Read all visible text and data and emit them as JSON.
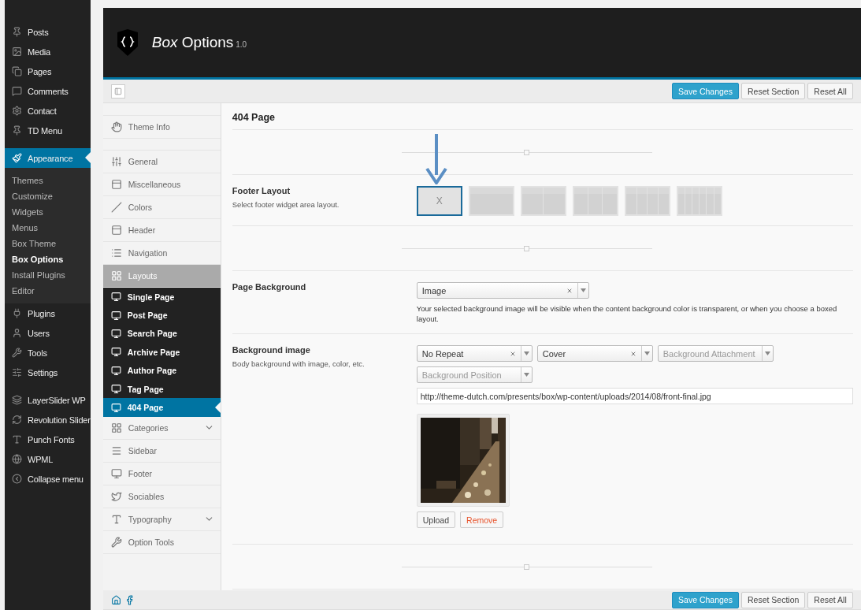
{
  "admin_menu": {
    "groups": [
      {
        "items": [
          {
            "label": "Posts",
            "selected": false
          },
          {
            "label": "Media",
            "selected": false
          },
          {
            "label": "Pages",
            "selected": false
          },
          {
            "label": "Comments",
            "selected": false
          },
          {
            "label": "Contact",
            "selected": false
          },
          {
            "label": "TD Menu",
            "selected": false
          }
        ]
      },
      {
        "items": [
          {
            "label": "Appearance",
            "selected": true,
            "children": [
              {
                "label": "Themes",
                "selected": false
              },
              {
                "label": "Customize",
                "selected": false
              },
              {
                "label": "Widgets",
                "selected": false
              },
              {
                "label": "Menus",
                "selected": false
              },
              {
                "label": "Box Theme",
                "selected": false
              },
              {
                "label": "Box Options",
                "selected": true
              },
              {
                "label": "Install Plugins",
                "selected": false
              },
              {
                "label": "Editor",
                "selected": false
              }
            ]
          },
          {
            "label": "Plugins",
            "selected": false
          },
          {
            "label": "Users",
            "selected": false
          },
          {
            "label": "Tools",
            "selected": false
          },
          {
            "label": "Settings",
            "selected": false
          }
        ]
      },
      {
        "items": [
          {
            "label": "LayerSlider WP",
            "selected": false
          },
          {
            "label": "Revolution Slider",
            "selected": false
          },
          {
            "label": "Punch Fonts",
            "selected": false
          },
          {
            "label": "WPML",
            "selected": false
          },
          {
            "label": "Collapse menu",
            "selected": false
          }
        ]
      }
    ]
  },
  "header": {
    "title_italic": "Box",
    "title": "Options",
    "version": "1.0"
  },
  "toolbar": {
    "buttons": [
      "Save Changes",
      "Reset Section",
      "Reset All"
    ]
  },
  "options_nav": {
    "groups": [
      {
        "items": [
          {
            "label": "Theme Info",
            "selected": false
          }
        ]
      },
      {
        "items": [
          {
            "label": "General",
            "selected": false
          },
          {
            "label": "Miscellaneous",
            "selected": false
          },
          {
            "label": "Colors",
            "selected": false
          },
          {
            "label": "Header",
            "selected": false
          },
          {
            "label": "Navigation",
            "selected": false
          },
          {
            "label": "Layouts",
            "selected": true,
            "children": [
              {
                "label": "Single Page",
                "selected": false
              },
              {
                "label": "Post Page",
                "selected": false
              },
              {
                "label": "Search Page",
                "selected": false
              },
              {
                "label": "Archive Page",
                "selected": false
              },
              {
                "label": "Author Page",
                "selected": false
              },
              {
                "label": "Tag Page",
                "selected": false
              },
              {
                "label": "404 Page",
                "selected": true
              }
            ]
          },
          {
            "label": "Categories",
            "selected": false,
            "expanded": false
          },
          {
            "label": "Sidebar",
            "selected": false
          },
          {
            "label": "Footer",
            "selected": false
          },
          {
            "label": "Sociables",
            "selected": false
          },
          {
            "label": "Typography",
            "selected": false,
            "expanded": false
          },
          {
            "label": "Option Tools",
            "selected": false
          }
        ]
      }
    ]
  },
  "section": {
    "title": "404 Page",
    "rows": [
      {
        "kind": "divider"
      },
      {
        "kind": "layout",
        "label": "Footer Layout",
        "description": "Select footer widget area layout.",
        "options": [
          {
            "kind": "none",
            "label": "X",
            "selected": true
          },
          {
            "kind": "one",
            "selected": false
          },
          {
            "kind": "two",
            "selected": false
          },
          {
            "kind": "three",
            "selected": false
          },
          {
            "kind": "four",
            "selected": false
          },
          {
            "kind": "six",
            "selected": false
          }
        ]
      },
      {
        "kind": "divider"
      },
      {
        "kind": "select",
        "label": "Page Background",
        "value": "Image",
        "help": "Your selected background image will be visible when the content background color is transparent, or when you choose a boxed layout."
      },
      {
        "kind": "background",
        "label": "Background image",
        "description": "Body background with image, color, etc.",
        "selects": [
          {
            "value": "No Repeat"
          },
          {
            "value": "Cover"
          },
          {
            "placeholder": "Background Attachment"
          },
          {
            "placeholder": "Background Position"
          }
        ],
        "url": "http://theme-dutch.com/presents/box/wp-content/uploads/2014/08/front-final.jpg",
        "preview": {
          "kind": "picture"
        },
        "buttons": [
          {
            "label": "Upload",
            "kind": "default"
          },
          {
            "label": "Remove",
            "kind": "danger"
          }
        ]
      },
      {
        "kind": "divider"
      }
    ]
  },
  "footer_bar": {
    "buttons": [
      "Save Changes",
      "Reset Section",
      "Reset All"
    ]
  }
}
